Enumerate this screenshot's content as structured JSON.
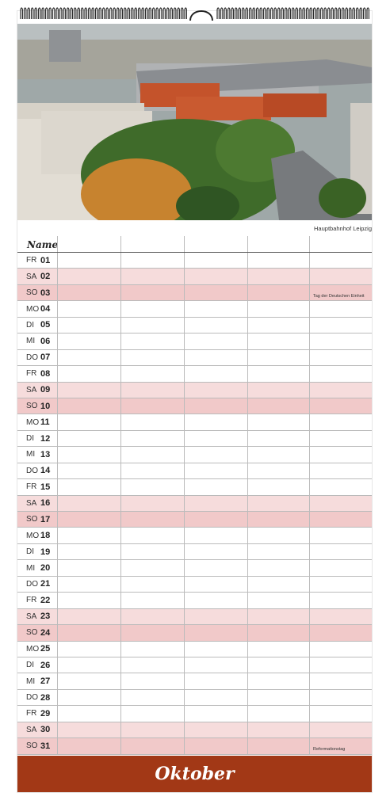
{
  "photo": {
    "caption": "Hauptbahnhof Leipzig",
    "colors": {
      "sky": "#b9c9d6",
      "greenery": "#3f6b2a",
      "roofs": "#c4532b",
      "buildings": "#cfcac2",
      "tracks": "#8a8d91"
    }
  },
  "header": {
    "name_label": "Name"
  },
  "days": [
    {
      "dow": "FR",
      "num": "01",
      "type": "weekday",
      "note": ""
    },
    {
      "dow": "SA",
      "num": "02",
      "type": "sat",
      "note": ""
    },
    {
      "dow": "SO",
      "num": "03",
      "type": "sun",
      "note": "Tag der Deutschen Einheit"
    },
    {
      "dow": "MO",
      "num": "04",
      "type": "weekday",
      "note": ""
    },
    {
      "dow": "DI",
      "num": "05",
      "type": "weekday",
      "note": ""
    },
    {
      "dow": "MI",
      "num": "06",
      "type": "weekday",
      "note": ""
    },
    {
      "dow": "DO",
      "num": "07",
      "type": "weekday",
      "note": ""
    },
    {
      "dow": "FR",
      "num": "08",
      "type": "weekday",
      "note": ""
    },
    {
      "dow": "SA",
      "num": "09",
      "type": "sat",
      "note": ""
    },
    {
      "dow": "SO",
      "num": "10",
      "type": "sun",
      "note": ""
    },
    {
      "dow": "MO",
      "num": "11",
      "type": "weekday",
      "note": ""
    },
    {
      "dow": "DI",
      "num": "12",
      "type": "weekday",
      "note": ""
    },
    {
      "dow": "MI",
      "num": "13",
      "type": "weekday",
      "note": ""
    },
    {
      "dow": "DO",
      "num": "14",
      "type": "weekday",
      "note": ""
    },
    {
      "dow": "FR",
      "num": "15",
      "type": "weekday",
      "note": ""
    },
    {
      "dow": "SA",
      "num": "16",
      "type": "sat",
      "note": ""
    },
    {
      "dow": "SO",
      "num": "17",
      "type": "sun",
      "note": ""
    },
    {
      "dow": "MO",
      "num": "18",
      "type": "weekday",
      "note": ""
    },
    {
      "dow": "DI",
      "num": "19",
      "type": "weekday",
      "note": ""
    },
    {
      "dow": "MI",
      "num": "20",
      "type": "weekday",
      "note": ""
    },
    {
      "dow": "DO",
      "num": "21",
      "type": "weekday",
      "note": ""
    },
    {
      "dow": "FR",
      "num": "22",
      "type": "weekday",
      "note": ""
    },
    {
      "dow": "SA",
      "num": "23",
      "type": "sat",
      "note": ""
    },
    {
      "dow": "SO",
      "num": "24",
      "type": "sun",
      "note": ""
    },
    {
      "dow": "MO",
      "num": "25",
      "type": "weekday",
      "note": ""
    },
    {
      "dow": "DI",
      "num": "26",
      "type": "weekday",
      "note": ""
    },
    {
      "dow": "MI",
      "num": "27",
      "type": "weekday",
      "note": ""
    },
    {
      "dow": "DO",
      "num": "28",
      "type": "weekday",
      "note": ""
    },
    {
      "dow": "FR",
      "num": "29",
      "type": "weekday",
      "note": ""
    },
    {
      "dow": "SA",
      "num": "30",
      "type": "sat",
      "note": ""
    },
    {
      "dow": "SO",
      "num": "31",
      "type": "sun",
      "note": "Reformationstag"
    }
  ],
  "month": {
    "label": "Oktober",
    "color": "#a23816"
  },
  "row_colors": {
    "sat": "#f6dcdc",
    "sun": "#f1c9c9"
  }
}
